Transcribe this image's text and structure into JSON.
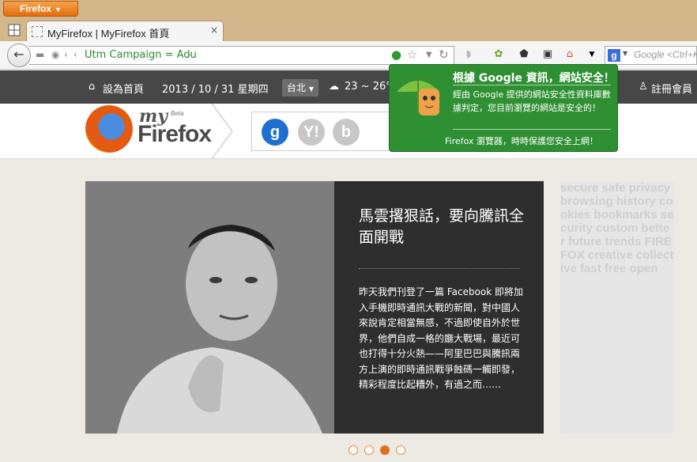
{
  "window": {
    "app_menu_label": "Firefox",
    "tab_title": "MyFirefox | MyFirefox 首頁",
    "tab_close": "×"
  },
  "navbar": {
    "url": "Utm Campaign = Adu",
    "search_placeholder": "Google <Ctrl+K>",
    "search_engine": "g"
  },
  "site_header": {
    "set_home": "設為首頁",
    "date": "2013 / 10 / 31 星期四",
    "city": "台北",
    "weather": "23 ~ 26°",
    "register": "註冊會員"
  },
  "logo": {
    "my": "my",
    "beta": "Beta",
    "firefox": "Firefox"
  },
  "engines": [
    {
      "label": "g",
      "color": "#1f6fd1"
    },
    {
      "label": "Y!",
      "color": "#c7c7c7"
    },
    {
      "label": "b",
      "color": "#c7c7c7"
    }
  ],
  "popup": {
    "headline": "根據 Google 資訊，網站安全！",
    "body": "經由 Google 提供的網站安全性資料庫數據判定，您目前瀏覽的網站是安全的！",
    "footer": "Firefox 瀏覽器，時時保護您安全上網！"
  },
  "article": {
    "title": "馬雲撂狠話，要向騰訊全面開戰",
    "excerpt": "昨天我們刊登了一篇 Facebook 即將加入手機即時通訊大戰的新聞，對中國人來說肯定相當無感，不過即使自外於世界，他們自成一格的廳大戰場，最近可也打得十分火熱——阿里巴巴與騰訊兩方上演的即時通訊戰爭蝕碼一觸即發，精彩程度比起糟外，有過之而……"
  },
  "side_image_text": "secure safe privacy browsing history cookies bookmarks security custom better future trends FIREFOX creative collective fast free open",
  "carousel": {
    "count": 4,
    "active": 2
  },
  "colors": {
    "titlebar": "#d3b689",
    "appmenu": "#e46c0d",
    "site_header": "#474747",
    "popup": "#2f8f33",
    "url_text": "#2a8a2a",
    "carousel_accent": "#e0701b"
  }
}
